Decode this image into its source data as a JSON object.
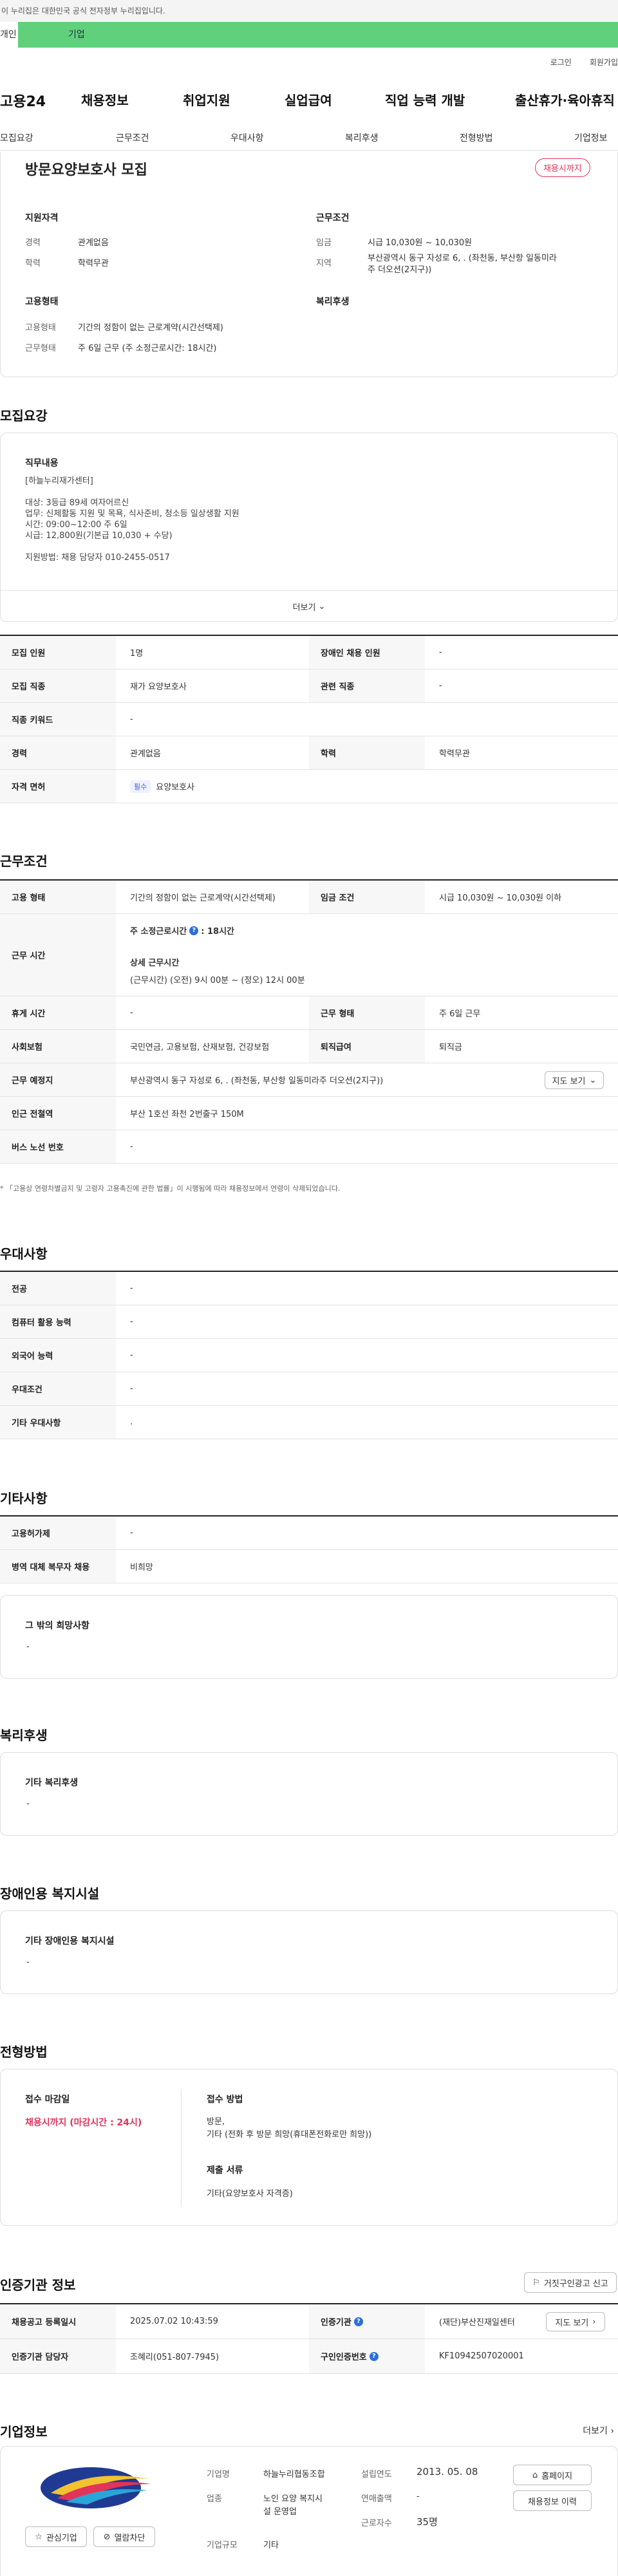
{
  "gov_banner": "이 누리집은 대한민국 공식 전자정부 누리집입니다.",
  "top_tabs": {
    "t1": "개인",
    "t2": "기업"
  },
  "utility": {
    "login": "로그인",
    "join": "회원가입"
  },
  "logo": "고용24",
  "gnb": [
    "채용정보",
    "취업지원",
    "실업급여",
    "직업 능력 개발",
    "출산휴가·육아휴직"
  ],
  "sub_nav": [
    "모집요강",
    "근무조건",
    "우대사항",
    "복리후생",
    "전형방법",
    "기업정보"
  ],
  "job": {
    "title": "방문요양보호사 모집",
    "status_badge": "채용시까지",
    "qual_title": "지원자격",
    "career_label": "경력",
    "career_value": "관계없음",
    "edu_label": "학력",
    "edu_value": "학력무관",
    "cond_title": "근무조건",
    "wage_label": "임금",
    "wage_value": "시급 10,030원 ~ 10,030원",
    "loc_label": "지역",
    "loc_value1": "부산광역시 동구 자성로 6, . (좌천동, 부산항 일동미라",
    "loc_value2": "주 더오션(2지구))",
    "emp_title": "고용형태",
    "emp_type_label": "고용형태",
    "emp_type_value": "기간의 정함이 없는 근로계약(시간선택제)",
    "work_type_label": "근무형태",
    "work_type_value": "주 6일 근무 (주 소정근로시간: 18시간)",
    "welfare_title": "복리후생"
  },
  "recruit": {
    "section_title": "모집요강",
    "duty_title": "직무내용",
    "lines": [
      "[하늘누리재가센터]",
      "",
      "대상: 3등급 89세 여자어르신",
      "업무: 신체활동 지원 및 목욕, 식사준비, 청소등 일상생활 지원",
      "시간: 09:00~12:00 주 6일",
      "시급: 12,800원(기본급 10,030 + 수당)",
      "",
      "지원방법: 채용 담당자 010-2455-0517"
    ],
    "more": "더보기",
    "rows": [
      {
        "l1": "모집 인원",
        "v1": "1명",
        "l2": "장애인 채용 인원",
        "v2": "-"
      },
      {
        "l1": "모집 직종",
        "v1": "재가 요양보호사",
        "l2": "관련 직종",
        "v2": "-"
      },
      {
        "l1": "직종 키워드",
        "v1": "-"
      },
      {
        "l1": "경력",
        "v1": "관계없음",
        "l2": "학력",
        "v2": "학력무관"
      },
      {
        "l1": "자격 면허",
        "tag": "필수",
        "v1": "요양보호사"
      }
    ]
  },
  "conditions": {
    "section_title": "근무조건",
    "emp_label": "고용 형태",
    "emp_value": "기간의 정함이 없는 근로계약(시간선택제)",
    "wage_label": "임금 조건",
    "wage_value": "시급 10,030원 ~ 10,030원 이하",
    "time_label": "근무 시간",
    "weekly_label": "주 소정근로시간",
    "weekly_value": ": 18시간",
    "detail_label": "상세 근무시간",
    "detail_value": "(근무시간) (오전) 9시 00분 ~ (정오) 12시 00분",
    "holiday_label": "휴게 시간",
    "holiday_value": "-",
    "worktype_label": "근무 형태",
    "worktype_value": "주 6일 근무",
    "insurance_label": "사회보험",
    "insurance_value": "국민연금, 고용보험, 산재보험, 건강보험",
    "severance_label": "퇴직급여",
    "severance_value": "퇴직금",
    "place_label": "근무 예정지",
    "place_value": "부산광역시 동구 자성로 6, . (좌천동, 부산항 일동미라주 더오션(2지구))",
    "map_btn": "지도 보기",
    "subway_label": "인근 전철역",
    "subway_value": "부산 1호선 좌천 2번출구 150M",
    "bus_label": "버스 노선 번호",
    "bus_value": "-",
    "note": "* 「고용상 연령차별금지 및 고령자 고용촉진에 관한 법률」이 시행됨에 따라 채용정보에서 연령이 삭제되었습니다."
  },
  "preference": {
    "section_title": "우대사항",
    "rows": [
      {
        "l": "전공",
        "v": "-"
      },
      {
        "l": "컴퓨터 활용 능력",
        "v": "-"
      },
      {
        "l": "외국어 능력",
        "v": "-"
      },
      {
        "l": "우대조건",
        "v": "-"
      },
      {
        "l": "기타 우대사항",
        "v": "."
      }
    ]
  },
  "etc": {
    "section_title": "기타사항",
    "rows": [
      {
        "l": "고용허가제",
        "v": "-"
      },
      {
        "l": "병역 대체 복무자 채용",
        "v": "비희망"
      }
    ],
    "box_title": "그 밖의 희망사항",
    "box_value": "-"
  },
  "welfare": {
    "section_title": "복리후생",
    "box_title": "기타 복리후생",
    "box_value": "-"
  },
  "disabled": {
    "section_title": "장애인용 복지시설",
    "box_title": "기타 장애인용 복지시설",
    "box_value": "-"
  },
  "selection": {
    "section_title": "전형방법",
    "deadline_title": "접수 마감일",
    "deadline_value": "채용시까지 (마감시간 : 24시)",
    "method_title": "접수 방법",
    "method_v1": "방문,",
    "method_v2": "기타 (전화 후 방문 희망(휴대폰전화로만 희망))",
    "docs_title": "제출 서류",
    "docs_value": "기타(요양보호사 자격증)"
  },
  "agency": {
    "section_title": "인증기관 정보",
    "report_btn": "거짓구인광고 신고",
    "reg_label": "채용공고 등록일시",
    "reg_value": "2025.07.02 10:43:59",
    "org_label": "인증기관",
    "org_value": "(재단)부산진재일센터",
    "map_btn": "지도 보기",
    "mgr_label": "인증기관 담당자",
    "mgr_value": "조혜리(051-807-7945)",
    "num_label": "구인인증번호",
    "num_value": "KF10942507020001"
  },
  "company": {
    "section_title": "기업정보",
    "more": "더보기",
    "name_l": "기업명",
    "name_v": "하늘누리협동조합",
    "ind_l": "업종",
    "ind_v1": "노인 요양 복지시",
    "ind_v2": "설 운영업",
    "size_l": "기업규모",
    "size_v": "기타",
    "est_l": "설립연도",
    "est_v": "2013. 05. 08",
    "sales_l": "연매출액",
    "sales_v": "-",
    "emp_l": "근로자수",
    "emp_v": "35명",
    "home_btn": "홈페이지",
    "jobs_btn": "채용정보 이력",
    "fav_btn": "관심기업",
    "block_btn": "열람차단"
  }
}
